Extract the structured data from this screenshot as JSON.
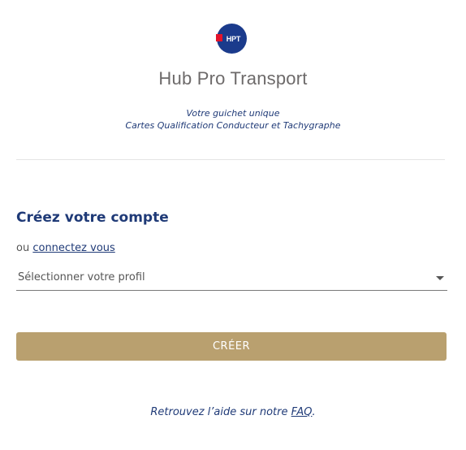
{
  "brand": {
    "logo_text": "HPT",
    "logo_bg": "#1b3b8c",
    "logo_flag": "#e3132b",
    "app_title": "Hub Pro Transport",
    "tagline_1": "Votre guichet unique",
    "tagline_2": "Cartes Qualification Conducteur et Tachygraphe"
  },
  "form": {
    "title": "Créez votre compte",
    "login_prefix": "ou",
    "login_link": "connectez vous",
    "profile_select": {
      "value": "Sélectionner votre profil",
      "icon": "caret-down-icon"
    },
    "submit_label": "CRÉER"
  },
  "help": {
    "text": "Retrouvez l’aide sur notre",
    "faq_link": "FAQ",
    "suffix": "."
  },
  "colors": {
    "primary_blue": "#1f3a77",
    "accent_gold": "#b9a06f",
    "title_gray": "#6d6a6a"
  }
}
